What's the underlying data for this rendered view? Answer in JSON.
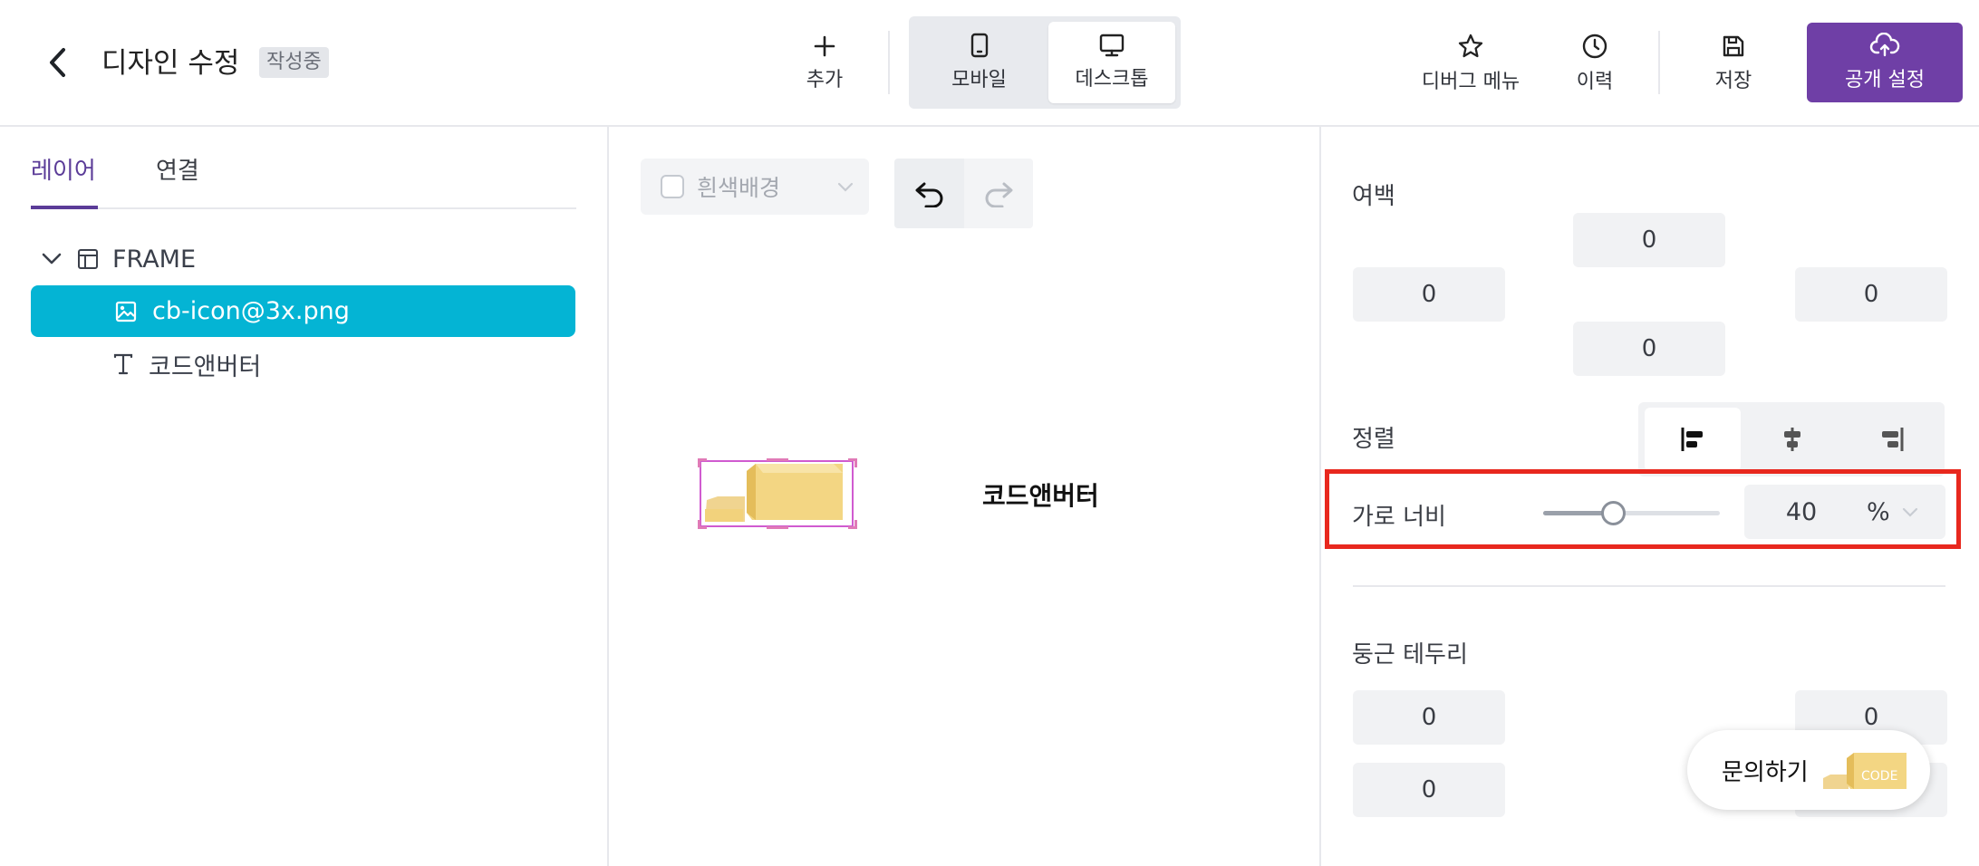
{
  "header": {
    "title": "디자인 수정",
    "status": "작성중",
    "add_label": "추가",
    "view_mobile": "모바일",
    "view_desktop": "데스크톱",
    "debug_menu": "디버그 메뉴",
    "history": "이력",
    "save": "저장",
    "publish": "공개 설정"
  },
  "left": {
    "tabs": [
      "레이어",
      "연결"
    ],
    "tree": {
      "frame": "FRAME",
      "image": "cb-icon@3x.png",
      "text": "코드앤버터"
    }
  },
  "canvas": {
    "bg_label": "흰색배경",
    "text": "코드앤버터"
  },
  "right": {
    "margin": {
      "label": "여백",
      "top": "0",
      "left": "0",
      "right": "0",
      "bottom": "0"
    },
    "align": {
      "label": "정렬",
      "selected": "left"
    },
    "width": {
      "label": "가로 너비",
      "value": "40",
      "unit": "%",
      "slider_fraction": 0.4
    },
    "radius": {
      "label": "둥근 테두리",
      "top_left": "0",
      "top_right": "0",
      "bottom_left": "0"
    }
  },
  "inquiry": {
    "label": "문의하기",
    "logo_text": "CODE"
  },
  "colors": {
    "accent": "#6f3fa6",
    "selected_row": "#04b4d4",
    "highlight": "#e8281e"
  },
  "icons": {
    "back": "chevron-left-icon",
    "add": "plus-icon",
    "mobile": "smartphone-icon",
    "desktop": "monitor-icon",
    "debug": "star-icon",
    "history": "clock-icon",
    "save": "floppy-disk-icon",
    "publish": "cloud-upload-icon"
  }
}
